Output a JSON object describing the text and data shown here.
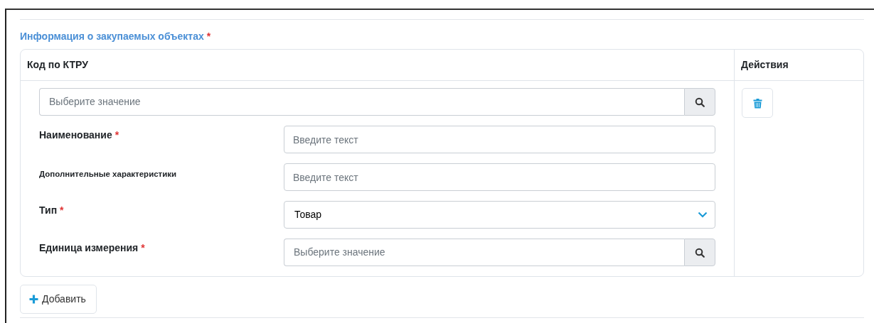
{
  "section": {
    "title": "Информация о закупаемых объектах",
    "mark": "*"
  },
  "table": {
    "columns": [
      "Код по КТРУ",
      "Действия"
    ],
    "rows": [
      {
        "ktru": {
          "placeholder": "Выберите значение"
        },
        "fields": [
          {
            "label": "Наименование",
            "mark": "*",
            "kind": "text",
            "placeholder": "Введите текст"
          },
          {
            "label": "Дополнительные характеристики",
            "small_label": true,
            "kind": "text",
            "placeholder": "Введите текст"
          },
          {
            "label": "Тип",
            "mark": "*",
            "kind": "select",
            "value": "Товар"
          },
          {
            "label": "Единица измерения",
            "mark": "*",
            "kind": "lookup",
            "placeholder": "Выберите значение"
          }
        ],
        "actions": [
          {
            "kind": "delete"
          }
        ]
      }
    ]
  },
  "add_button": {
    "label": "Добавить"
  }
}
